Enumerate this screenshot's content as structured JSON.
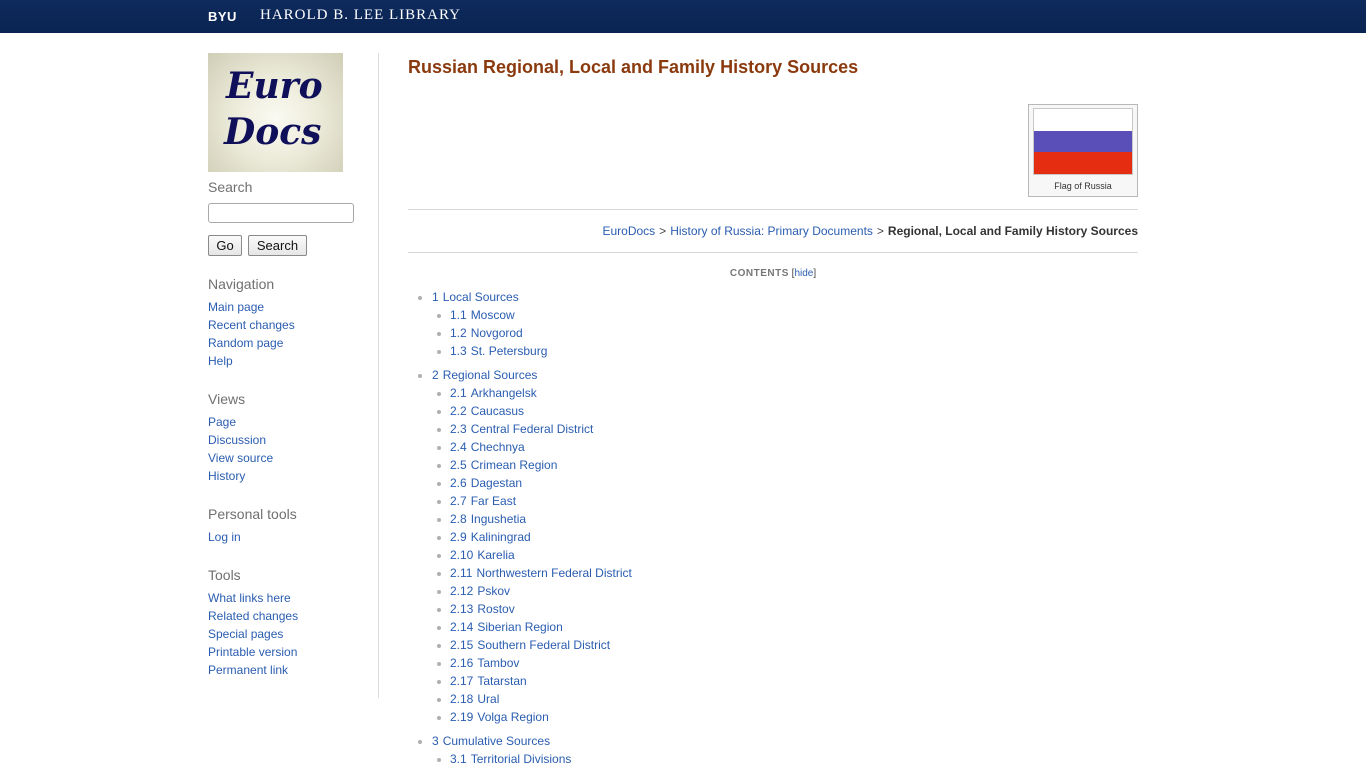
{
  "header": {
    "byu": "BYU",
    "library": "HAROLD B. LEE LIBRARY"
  },
  "logo": {
    "line1": "Euro",
    "line2": "Docs"
  },
  "search": {
    "heading": "Search",
    "go_label": "Go",
    "search_label": "Search",
    "value": ""
  },
  "navigation": {
    "heading": "Navigation",
    "items": [
      "Main page",
      "Recent changes",
      "Random page",
      "Help"
    ]
  },
  "views": {
    "heading": "Views",
    "items": [
      "Page",
      "Discussion",
      "View source",
      "History"
    ]
  },
  "personal": {
    "heading": "Personal tools",
    "items": [
      "Log in"
    ]
  },
  "tools": {
    "heading": "Tools",
    "items": [
      "What links here",
      "Related changes",
      "Special pages",
      "Printable version",
      "Permanent link"
    ]
  },
  "page": {
    "title": "Russian Regional, Local and Family History Sources"
  },
  "flag": {
    "caption": "Flag of Russia",
    "colors": [
      "#ffffff",
      "#5a4fb8",
      "#e52d12"
    ]
  },
  "breadcrumb": {
    "link1": "EuroDocs",
    "link2": "History of Russia: Primary Documents",
    "current": "Regional, Local and Family History Sources",
    "separator": ">"
  },
  "toc": {
    "heading": "CONTENTS",
    "toggle_open": "[",
    "toggle": "hide",
    "toggle_close": "]",
    "sections": [
      {
        "num": "1",
        "label": "Local Sources",
        "items": [
          {
            "num": "1.1",
            "label": "Moscow"
          },
          {
            "num": "1.2",
            "label": "Novgorod"
          },
          {
            "num": "1.3",
            "label": "St. Petersburg"
          }
        ]
      },
      {
        "num": "2",
        "label": "Regional Sources",
        "items": [
          {
            "num": "2.1",
            "label": "Arkhangelsk"
          },
          {
            "num": "2.2",
            "label": "Caucasus"
          },
          {
            "num": "2.3",
            "label": "Central Federal District"
          },
          {
            "num": "2.4",
            "label": "Chechnya"
          },
          {
            "num": "2.5",
            "label": "Crimean Region"
          },
          {
            "num": "2.6",
            "label": "Dagestan"
          },
          {
            "num": "2.7",
            "label": "Far East"
          },
          {
            "num": "2.8",
            "label": "Ingushetia"
          },
          {
            "num": "2.9",
            "label": "Kaliningrad"
          },
          {
            "num": "2.10",
            "label": "Karelia"
          },
          {
            "num": "2.11",
            "label": "Northwestern Federal District"
          },
          {
            "num": "2.12",
            "label": "Pskov"
          },
          {
            "num": "2.13",
            "label": "Rostov"
          },
          {
            "num": "2.14",
            "label": "Siberian Region"
          },
          {
            "num": "2.15",
            "label": "Southern Federal District"
          },
          {
            "num": "2.16",
            "label": "Tambov"
          },
          {
            "num": "2.17",
            "label": "Tatarstan"
          },
          {
            "num": "2.18",
            "label": "Ural"
          },
          {
            "num": "2.19",
            "label": "Volga Region"
          }
        ]
      },
      {
        "num": "3",
        "label": "Cumulative Sources",
        "items": [
          {
            "num": "3.1",
            "label": "Territorial Divisions"
          }
        ]
      }
    ]
  }
}
